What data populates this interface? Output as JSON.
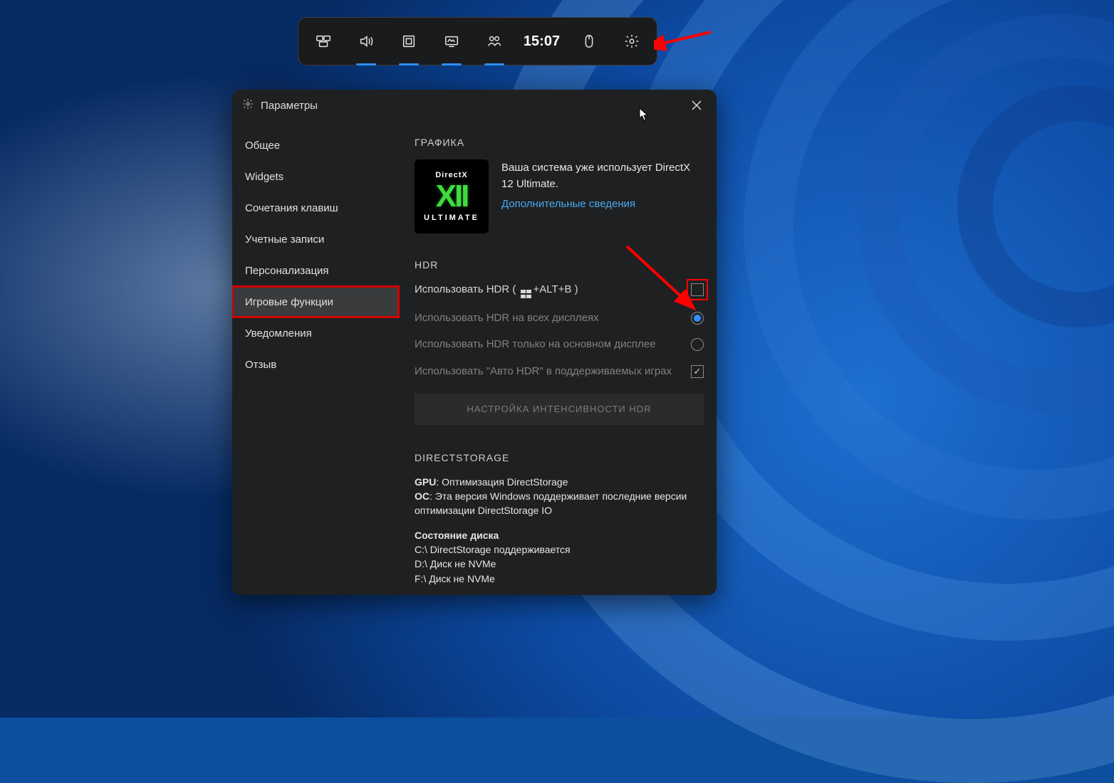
{
  "gamebar": {
    "time": "15:07"
  },
  "window": {
    "title": "Параметры",
    "sidebar": {
      "items": [
        {
          "label": "Общее"
        },
        {
          "label": "Widgets"
        },
        {
          "label": "Сочетания клавиш"
        },
        {
          "label": "Учетные записи"
        },
        {
          "label": "Персонализация"
        },
        {
          "label": "Игровые функции",
          "selected": true
        },
        {
          "label": "Уведомления"
        },
        {
          "label": "Отзыв"
        }
      ]
    },
    "graphics": {
      "section": "ГРАФИКА",
      "dx_top": "DirectX",
      "dx_mid": "XII",
      "dx_bot": "ULTIMATE",
      "desc": "Ваша система уже использует DirectX 12 Ultimate.",
      "link": "Дополнительные сведения"
    },
    "hdr": {
      "section": "HDR",
      "use_hdr_prefix": "Использовать HDR ( ",
      "use_hdr_suffix": "+ALT+B )",
      "all_displays": "Использовать HDR на всех дисплеях",
      "primary_only": "Использовать HDR только на основном дисплее",
      "auto_hdr": "Использовать \"Авто HDR\" в поддерживаемых играх",
      "intensity_button": "НАСТРОЙКА ИНТЕНСИВНОСТИ HDR"
    },
    "directstorage": {
      "section": "DIRECTSTORAGE",
      "gpu_label": "GPU",
      "gpu_value": ": Оптимизация DirectStorage",
      "os_label": "ОС",
      "os_value": ": Эта версия Windows поддерживает последние версии оптимизации DirectStorage IO",
      "disk_state": "Состояние диска",
      "drives": [
        "C:\\ DirectStorage поддерживается",
        "D:\\ Диск не NVMe",
        "F:\\ Диск не NVMe"
      ]
    }
  }
}
